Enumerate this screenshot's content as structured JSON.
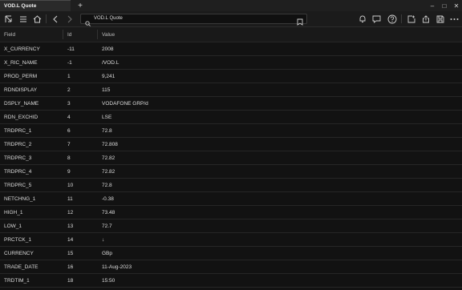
{
  "window": {
    "tab_title": "VOD.L Quote",
    "new_tab_label": "+",
    "minimize_label": "–",
    "maximize_label": "□",
    "close_label": "✕"
  },
  "toolbar": {
    "address_value": "VOD.L Quote",
    "icons": [
      "launch-icon",
      "menu-icon",
      "home-icon",
      "back-icon",
      "forward-icon",
      "search-icon",
      "bookmark-icon",
      "bell-icon",
      "chat-icon",
      "help-icon",
      "new-window-icon",
      "share-icon",
      "save-icon",
      "more-icon"
    ]
  },
  "table": {
    "columns": [
      "Field",
      "Id",
      "Value"
    ],
    "rows": [
      {
        "field": "X_CURRENCY",
        "id": "-11",
        "value": "2008"
      },
      {
        "field": "X_RIC_NAME",
        "id": "-1",
        "value": "/VOD.L"
      },
      {
        "field": "PROD_PERM",
        "id": "1",
        "value": "9,241"
      },
      {
        "field": "RDNDISPLAY",
        "id": "2",
        "value": "115"
      },
      {
        "field": "DSPLY_NAME",
        "id": "3",
        "value": "VODAFONE GRP/d"
      },
      {
        "field": "RDN_EXCHID",
        "id": "4",
        "value": "LSE"
      },
      {
        "field": "TRDPRC_1",
        "id": "6",
        "value": "72.8"
      },
      {
        "field": "TRDPRC_2",
        "id": "7",
        "value": "72.808"
      },
      {
        "field": "TRDPRC_3",
        "id": "8",
        "value": "72.82"
      },
      {
        "field": "TRDPRC_4",
        "id": "9",
        "value": "72.82"
      },
      {
        "field": "TRDPRC_5",
        "id": "10",
        "value": "72.8"
      },
      {
        "field": "NETCHNG_1",
        "id": "11",
        "value": "-0.38"
      },
      {
        "field": "HIGH_1",
        "id": "12",
        "value": "73.48"
      },
      {
        "field": "LOW_1",
        "id": "13",
        "value": "72.7"
      },
      {
        "field": "PRCTCK_1",
        "id": "14",
        "value": "↓"
      },
      {
        "field": "CURRENCY",
        "id": "15",
        "value": "GBp"
      },
      {
        "field": "TRADE_DATE",
        "id": "16",
        "value": "11-Aug-2023"
      },
      {
        "field": "TRDTIM_1",
        "id": "18",
        "value": "15:50"
      }
    ]
  }
}
